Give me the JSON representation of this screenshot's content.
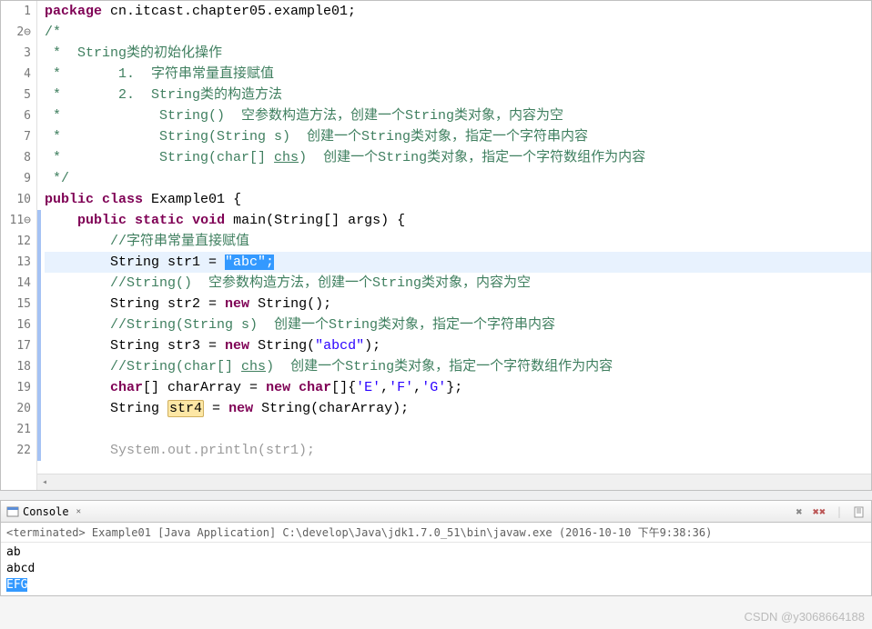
{
  "editor": {
    "lines": [
      {
        "n": 1,
        "type": "code",
        "segments": [
          [
            "kw",
            "package"
          ],
          [
            "plain",
            " cn.itcast.chapter05.example01;"
          ]
        ]
      },
      {
        "n": 2,
        "type": "code",
        "gutter_suffix": "⊖",
        "segments": [
          [
            "cmt",
            "/*"
          ]
        ]
      },
      {
        "n": 3,
        "type": "code",
        "segments": [
          [
            "cmt",
            " *  String类的初始化操作"
          ]
        ]
      },
      {
        "n": 4,
        "type": "code",
        "segments": [
          [
            "cmt",
            " *       1.  字符串常量直接赋值"
          ]
        ]
      },
      {
        "n": 5,
        "type": "code",
        "segments": [
          [
            "cmt",
            " *       2.  String类的构造方法"
          ]
        ]
      },
      {
        "n": 6,
        "type": "code",
        "segments": [
          [
            "cmt",
            " *            String()  空参数构造方法，创建一个String类对象，内容为空"
          ]
        ]
      },
      {
        "n": 7,
        "type": "code",
        "segments": [
          [
            "cmt",
            " *            String(String s)  创建一个String类对象，指定一个字符串内容"
          ]
        ]
      },
      {
        "n": 8,
        "type": "code",
        "segments": [
          [
            "cmt",
            " *            String(char[] "
          ],
          [
            "cmt under",
            "chs"
          ],
          [
            "cmt",
            ")  创建一个String类对象，指定一个字符数组作为内容"
          ]
        ]
      },
      {
        "n": 9,
        "type": "code",
        "segments": [
          [
            "cmt",
            " */"
          ]
        ]
      },
      {
        "n": 10,
        "type": "code",
        "segments": [
          [
            "kw",
            "public"
          ],
          [
            "plain",
            " "
          ],
          [
            "kw",
            "class"
          ],
          [
            "plain",
            " Example01 {"
          ]
        ]
      },
      {
        "n": 11,
        "type": "code",
        "gutter_suffix": "⊖",
        "bar": true,
        "segments": [
          [
            "plain",
            "    "
          ],
          [
            "kw",
            "public"
          ],
          [
            "plain",
            " "
          ],
          [
            "kw",
            "static"
          ],
          [
            "plain",
            " "
          ],
          [
            "kw",
            "void"
          ],
          [
            "plain",
            " main(String[] args) {"
          ]
        ]
      },
      {
        "n": 12,
        "type": "code",
        "bar": true,
        "segments": [
          [
            "plain",
            "        "
          ],
          [
            "cmt",
            "//字符串常量直接赋值"
          ]
        ]
      },
      {
        "n": 13,
        "type": "code",
        "bar": true,
        "highlight": true,
        "segments": [
          [
            "plain",
            "        String str1 = "
          ],
          [
            "selected",
            "\"abc\";"
          ]
        ]
      },
      {
        "n": 14,
        "type": "code",
        "bar": true,
        "segments": [
          [
            "plain",
            "        "
          ],
          [
            "cmt",
            "//String()  空参数构造方法，创建一个String类对象，内容为空"
          ]
        ]
      },
      {
        "n": 15,
        "type": "code",
        "bar": true,
        "segments": [
          [
            "plain",
            "        String str2 = "
          ],
          [
            "kw",
            "new"
          ],
          [
            "plain",
            " String();"
          ]
        ]
      },
      {
        "n": 16,
        "type": "code",
        "bar": true,
        "segments": [
          [
            "plain",
            "        "
          ],
          [
            "cmt",
            "//String(String s)  创建一个String类对象，指定一个字符串内容"
          ]
        ]
      },
      {
        "n": 17,
        "type": "code",
        "bar": true,
        "segments": [
          [
            "plain",
            "        String str3 = "
          ],
          [
            "kw",
            "new"
          ],
          [
            "plain",
            " String("
          ],
          [
            "str",
            "\"abcd\""
          ],
          [
            "plain",
            ");"
          ]
        ]
      },
      {
        "n": 18,
        "type": "code",
        "bar": true,
        "segments": [
          [
            "plain",
            "        "
          ],
          [
            "cmt",
            "//String(char[] "
          ],
          [
            "cmt under",
            "chs"
          ],
          [
            "cmt",
            ")  创建一个String类对象，指定一个字符数组作为内容"
          ]
        ]
      },
      {
        "n": 19,
        "type": "code",
        "bar": true,
        "segments": [
          [
            "plain",
            "        "
          ],
          [
            "kw",
            "char"
          ],
          [
            "plain",
            "[] charArray = "
          ],
          [
            "kw",
            "new"
          ],
          [
            "plain",
            " "
          ],
          [
            "kw",
            "char"
          ],
          [
            "plain",
            "[]{"
          ],
          [
            "chr",
            "'E'"
          ],
          [
            "plain",
            ","
          ],
          [
            "chr",
            "'F'"
          ],
          [
            "plain",
            ","
          ],
          [
            "chr",
            "'G'"
          ],
          [
            "plain",
            "};"
          ]
        ]
      },
      {
        "n": 20,
        "type": "code",
        "bar": true,
        "segments": [
          [
            "plain",
            "        String "
          ],
          [
            "occ",
            "str4"
          ],
          [
            "plain",
            " = "
          ],
          [
            "kw",
            "new"
          ],
          [
            "plain",
            " String(charArray);"
          ]
        ]
      },
      {
        "n": 21,
        "type": "code",
        "bar": true,
        "segments": [
          [
            "plain",
            ""
          ]
        ]
      },
      {
        "n": 22,
        "type": "code",
        "bar": true,
        "cut": true,
        "segments": [
          [
            "plain",
            "        Syst"
          ],
          [
            "plain faded",
            "em.out.println(str1);"
          ]
        ]
      }
    ]
  },
  "console": {
    "tab_label": "Console",
    "status": "<terminated> Example01 [Java Application] C:\\develop\\Java\\jdk1.7.0_51\\bin\\javaw.exe (2016-10-10 下午9:38:36)",
    "lines": [
      {
        "text": "ab",
        "selected": false
      },
      {
        "text": "abcd",
        "selected": false
      },
      {
        "text": "EFG",
        "selected": true
      }
    ]
  },
  "watermark": "CSDN @y3068664188"
}
